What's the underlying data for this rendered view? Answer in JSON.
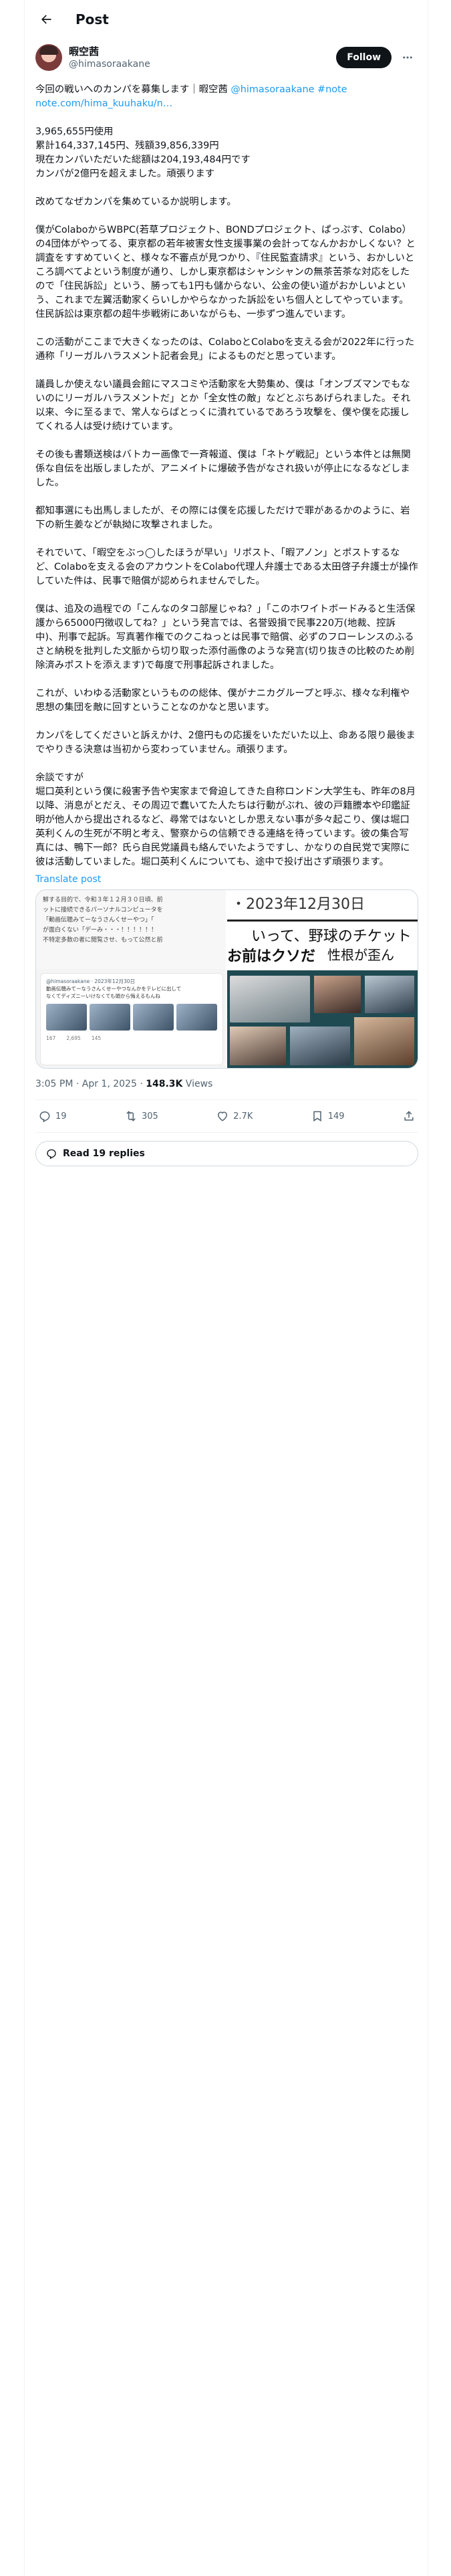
{
  "header": {
    "title": "Post"
  },
  "author": {
    "display_name": "暇空茜",
    "handle": "@himasoraakane"
  },
  "follow_label": "Follow",
  "post": {
    "intro": "今回の戦いへのカンパを募集します｜暇空茜 ",
    "intro_link": "@himasoraakane #note",
    "intro_url": "note.com/hima_kuuhaku/n…",
    "paragraphs": [
      "3,965,655円使用\n累計164,337,145円、残額39,856,339円\n現在カンパいただいた総額は204,193,484円です\nカンパが2億円を超えました。頑張ります",
      "改めてなぜカンパを集めているか説明します。",
      "僕がColaboからWBPC(若草プロジェクト、BONDプロジェクト、ぱっぷす、Colabo）の4団体がやってる、東京都の若年被害女性支援事業の会計ってなんかおかしくない？と調査をすすめていくと、様々な不審点が見つかり、『住民監査請求』という、おかしいところ調べてよという制度が通り、しかし東京都はシャンシャンの無茶苦茶な対応をしたので「住民訴訟」という、勝っても1円も儲からない、公金の使い道がおかしいよという、これまで左翼活動家くらいしかやらなかった訴訟をいち個人としてやっています。住民訴訟は東京都の超牛歩戦術にあいながらも、一歩ずつ進んでいます。",
      "この活動がここまで大きくなったのは、ColaboとColaboを支える会が2022年に行った通称「リーガルハラスメント記者会見」によるものだと思っています。",
      "議員しか使えない議員会館にマスコミや活動家を大勢集め、僕は「オンブズマンでもないのにリーガルハラスメントだ」とか「全女性の敵」などとぶちあげられました。それ以来、今に至るまで、常人ならばとっくに潰れているであろう攻撃を、僕や僕を応援してくれる人は受け続けています。",
      "その後も書類送検はバトカー画像で一斉報道、僕は「ネトゲ戦記」という本件とは無関係な自伝を出版しましたが、アニメイトに爆破予告がなされ扱いが停止になるなどしました。",
      "都知事選にも出馬しましたが、その際には僕を応援しただけで罪があるかのように、岩下の新生姜などが執拗に攻撃されました。",
      "それでいて、「暇空をぶっ◯したほうが早い」リポスト、「暇アノン」とポストするなど、Colaboを支える会のアカウントをColabo代理人弁護士である太田啓子弁護士が操作していた件は、民事で賠償が認められませんでした。",
      "僕は、追及の過程での「こんなのタコ部屋じゃね？」「このホワイトボードみると生活保護から65000円徴収してね？」という発言では、名誉毀損で民事220万(地裁、控訴中)、刑事で起訴。写真著作権でのクこねっとは民事で賠償、必ずのフローレンスのふるさと納税を批判した文脈から切り取った添付画像のような発言(切り抜きの比較のため削除済みポストを添えます)で毎度で刑事起訴されました。",
      "これが、いわゆる活動家というものの総体、僕がナニカグループと呼ぶ、様々な利権や思想の集団を敵に回すということなのかなと思います。",
      "カンパをしてくださいと訴えかけ、2億円もの応援をいただいた以上、命ある限り最後までやりきる決意は当初から変わっていません。頑張ります。",
      "余談ですが\n堀口英利という僕に殺害予告や実家まで脅迫してきた自称ロンドン大学生も、昨年の8月以降、消息がとだえ、その周辺で蠢いてた人たちは行動がぶれ、彼の戸籍謄本や印鑑証明が他人から提出されるなど、尋常ではないとしか思えない事が多々起こり、僕は堀口英利くんの生死が不明と考え、警察からの信頼できる連絡を待っています。彼の集合写真には、鴨下一郎？氏ら自民党議員も絡んでいたようですし、かなりの自民党で実際に彼は活動していました。堀口英利くんについても、途中で投げ出さず頑張ります。"
    ]
  },
  "translate_label": "Translate post",
  "media": {
    "left_text": "鮮する目的で、令和３年１２月３０日頃、前\nットに接続できるパーソナルコンピュータを\n「動画伝聴みてーなうさんくせーやつ」「\nが面白くない「デーみ・・・！！！！！！\n不特定多数の者に閲覧させ、もって公然と前",
    "left_tweet_handle": "@himasoraakane · 2023年12月30日",
    "left_tweet_text": "動画伝聴みてーなうさんくせーやつなんかをテレビに出して\nなくてディズニーいけなくても頭から悔えるもんね",
    "left_tweet_stats": [
      "167",
      "2,695",
      "145"
    ],
    "date_text": "・2023年12月30日",
    "banner_line1": "いって、野球のチケット",
    "banner_line2": "お前はクソだ",
    "banner_line3": "性根が歪ん"
  },
  "meta": {
    "time": "3:05 PM · Apr 1, 2025 · ",
    "views_count": "148.3K",
    "views_label": " Views"
  },
  "actions": {
    "replies": "19",
    "reposts": "305",
    "likes": "2.7K",
    "bookmarks": "149"
  },
  "read_replies_label": "Read 19 replies",
  "colors": {
    "accent": "#1d9bf0",
    "text": "#0f1419",
    "muted": "#536471",
    "border": "#cfd9de"
  }
}
